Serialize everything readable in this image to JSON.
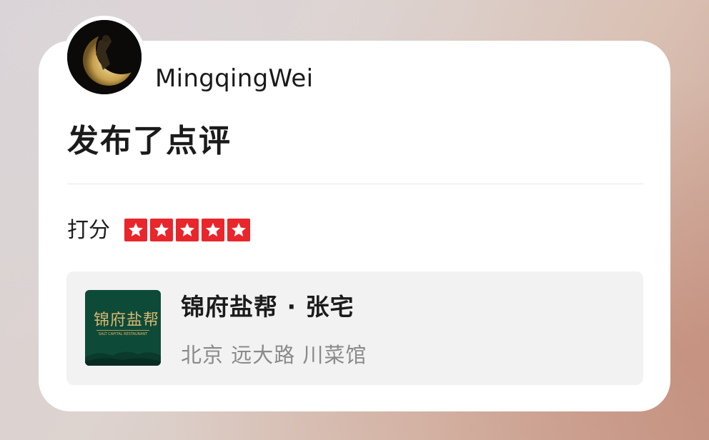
{
  "user": {
    "name": "MingqingWei",
    "avatar_icon": "crescent-moon-avatar"
  },
  "activity": {
    "action_text": "发布了点评"
  },
  "rating": {
    "label": "打分",
    "stars": 5,
    "max_stars": 5,
    "star_color": "#e8262b"
  },
  "shop": {
    "name": "锦府盐帮 · 张宅",
    "meta": "北京 远大路 川菜馆",
    "logo": {
      "title": "锦府盐帮",
      "subtitle": "SALT CAPITAL RESTAURANT",
      "bg_color": "#0e4a38",
      "accent_color": "#d8b66f"
    }
  },
  "colors": {
    "card_bg": "#ffffff",
    "panel_bg": "#f2f2f2",
    "muted_text": "#8a8a8a"
  }
}
